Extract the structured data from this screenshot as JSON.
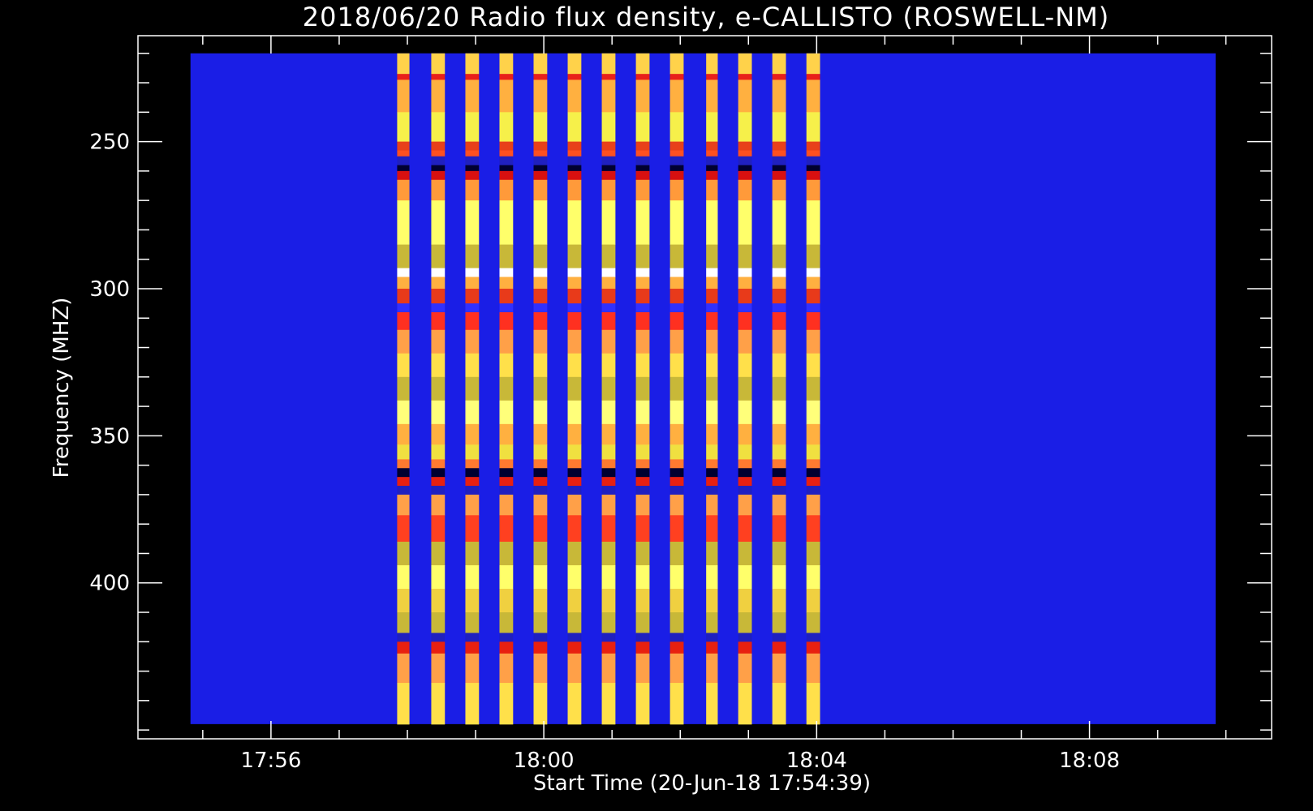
{
  "chart_data": {
    "type": "heatmap",
    "title": "2018/06/20  Radio flux density, e-CALLISTO (ROSWELL-NM)",
    "xlabel": "Start Time (20-Jun-18 17:54:39)",
    "ylabel": "Frequency (MHZ)",
    "x_ticks": [
      "17:56",
      "18:00",
      "18:04",
      "18:08"
    ],
    "x_tick_minutes": [
      96,
      100,
      104,
      108
    ],
    "y_ticks": [
      "250",
      "300",
      "350",
      "400"
    ],
    "y_tick_values": [
      250,
      300,
      350,
      400
    ],
    "xlim_minutes": [
      94.05,
      110.67
    ],
    "ylim_mhz": [
      214,
      453
    ],
    "y_inverted": true,
    "data_time_range_minutes": [
      94.82,
      109.85
    ],
    "data_freq_range_mhz": [
      220,
      448
    ],
    "background_color": "#1a1ee6",
    "burst_strips": [
      {
        "start": 97.85,
        "end": 98.03
      },
      {
        "start": 98.35,
        "end": 98.55
      },
      {
        "start": 98.85,
        "end": 99.05
      },
      {
        "start": 99.35,
        "end": 99.55
      },
      {
        "start": 99.85,
        "end": 100.05
      },
      {
        "start": 100.35,
        "end": 100.55
      },
      {
        "start": 100.85,
        "end": 101.05
      },
      {
        "start": 101.35,
        "end": 101.55
      },
      {
        "start": 101.85,
        "end": 102.05
      },
      {
        "start": 102.38,
        "end": 102.55
      },
      {
        "start": 102.85,
        "end": 103.05
      },
      {
        "start": 103.35,
        "end": 103.55
      },
      {
        "start": 103.85,
        "end": 104.05
      }
    ],
    "burst_bands": [
      {
        "from": 220,
        "to": 227,
        "color": "#ffd24a"
      },
      {
        "from": 227,
        "to": 229,
        "color": "#e8201a"
      },
      {
        "from": 229,
        "to": 240,
        "color": "#ffb040"
      },
      {
        "from": 240,
        "to": 250,
        "color": "#f6f04a"
      },
      {
        "from": 250,
        "to": 253,
        "color": "#e8401a"
      },
      {
        "from": 253,
        "to": 255,
        "color": "#ff5020"
      },
      {
        "from": 255,
        "to": 258,
        "color": "#2020c0"
      },
      {
        "from": 258,
        "to": 260,
        "color": "#000030"
      },
      {
        "from": 260,
        "to": 263,
        "color": "#d81010"
      },
      {
        "from": 263,
        "to": 270,
        "color": "#ff9a3a"
      },
      {
        "from": 270,
        "to": 285,
        "color": "#ffff6a"
      },
      {
        "from": 285,
        "to": 293,
        "color": "#c8b838"
      },
      {
        "from": 293,
        "to": 296,
        "color": "#ffffff"
      },
      {
        "from": 296,
        "to": 300,
        "color": "#ffb040"
      },
      {
        "from": 300,
        "to": 305,
        "color": "#e83a1a"
      },
      {
        "from": 305,
        "to": 308,
        "color": "#3030ff"
      },
      {
        "from": 308,
        "to": 314,
        "color": "#ff3020"
      },
      {
        "from": 314,
        "to": 322,
        "color": "#ffa048"
      },
      {
        "from": 322,
        "to": 330,
        "color": "#ffe04a"
      },
      {
        "from": 330,
        "to": 338,
        "color": "#c8b838"
      },
      {
        "from": 338,
        "to": 346,
        "color": "#ffff7a"
      },
      {
        "from": 346,
        "to": 353,
        "color": "#ffb040"
      },
      {
        "from": 353,
        "to": 358,
        "color": "#f0e040"
      },
      {
        "from": 358,
        "to": 361,
        "color": "#ff7a30"
      },
      {
        "from": 361,
        "to": 364,
        "color": "#000030"
      },
      {
        "from": 364,
        "to": 367,
        "color": "#e82010"
      },
      {
        "from": 367,
        "to": 370,
        "color": "#2020c0"
      },
      {
        "from": 370,
        "to": 377,
        "color": "#ffa048"
      },
      {
        "from": 377,
        "to": 386,
        "color": "#ff4020"
      },
      {
        "from": 386,
        "to": 394,
        "color": "#c8b838"
      },
      {
        "from": 394,
        "to": 402,
        "color": "#ffff6a"
      },
      {
        "from": 402,
        "to": 410,
        "color": "#f0d040"
      },
      {
        "from": 410,
        "to": 417,
        "color": "#c8b838"
      },
      {
        "from": 417,
        "to": 420,
        "color": "#2020c0"
      },
      {
        "from": 420,
        "to": 424,
        "color": "#e82010"
      },
      {
        "from": 424,
        "to": 434,
        "color": "#ffa048"
      },
      {
        "from": 434,
        "to": 448,
        "color": "#ffe04a"
      }
    ]
  }
}
